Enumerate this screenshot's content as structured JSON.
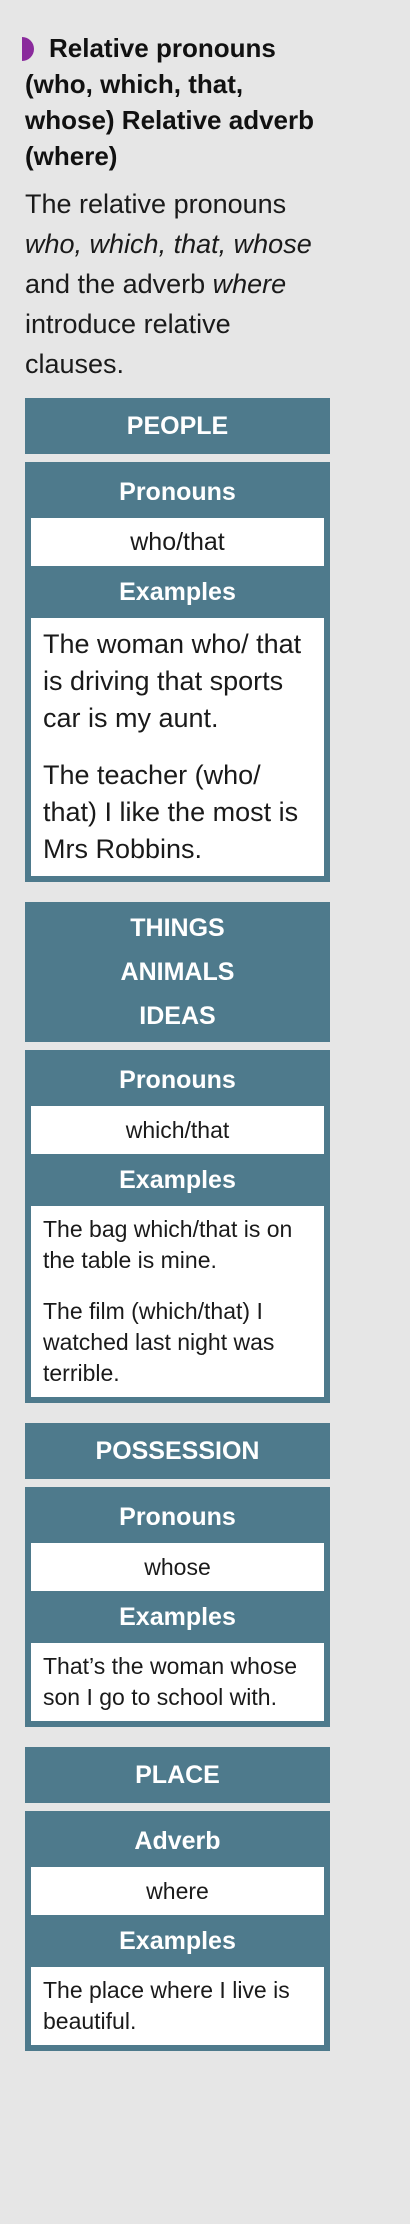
{
  "heading": {
    "title": "Relative pronouns (who, which, that, whose) Relative adverb (where)"
  },
  "intro": {
    "part1": "The relative pronouns ",
    "who": "who",
    "sep1": ", ",
    "which": "which",
    "sep2": ", ",
    "that": "that",
    "sep3": ",",
    "whose": "whose",
    "part2": " and the adverb ",
    "where": "where",
    "part3": " introduce relative clauses."
  },
  "sections": {
    "people": {
      "category": "PEOPLE",
      "pronouns_label": "Pronouns",
      "pronouns": "who/that",
      "examples_label": "Examples",
      "example1": "The woman who/ that is driving that sports car is my aunt.",
      "example2": "The teacher (who/ that) I like the most is Mrs Robbins."
    },
    "things": {
      "category_line1": "THINGS",
      "category_line2": "ANIMALS",
      "category_line3": "IDEAS",
      "pronouns_label": "Pronouns",
      "pronouns": "which/that",
      "examples_label": "Examples",
      "example1": "The bag which/that is on the table is mine.",
      "example2": "The film (which/that) I watched last night was terrible."
    },
    "possession": {
      "category": "POSSESSION",
      "pronouns_label": "Pronouns",
      "pronouns": "whose",
      "examples_label": "Examples",
      "example1": "That’s the woman whose son I go to school with."
    },
    "place": {
      "category": "PLACE",
      "adverb_label": "Adverb",
      "adverb": "where",
      "examples_label": "Examples",
      "example1": "The place where I live is beautiful."
    }
  },
  "colors": {
    "panel": "#4e7a8c",
    "accent": "#8a2a9c",
    "background": "#e6e6e6"
  }
}
